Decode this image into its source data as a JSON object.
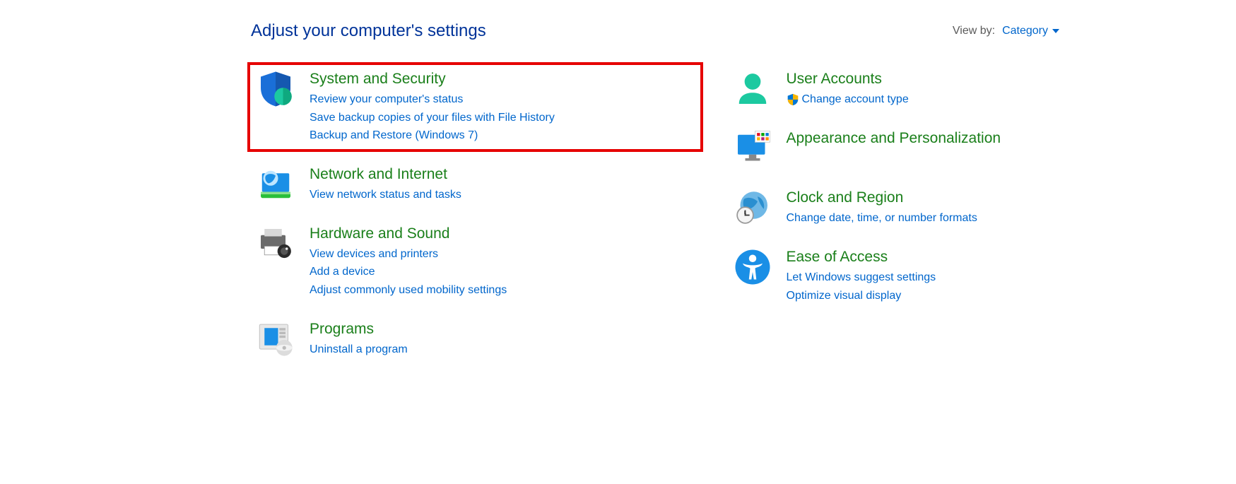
{
  "header": {
    "title": "Adjust your computer's settings",
    "view_by_label": "View by:",
    "view_by_value": "Category"
  },
  "left": [
    {
      "id": "system-and-security",
      "title": "System and Security",
      "links": [
        "Review your computer's status",
        "Save backup copies of your files with File History",
        "Backup and Restore (Windows 7)"
      ],
      "highlight": true
    },
    {
      "id": "network-and-internet",
      "title": "Network and Internet",
      "links": [
        "View network status and tasks"
      ]
    },
    {
      "id": "hardware-and-sound",
      "title": "Hardware and Sound",
      "links": [
        "View devices and printers",
        "Add a device",
        "Adjust commonly used mobility settings"
      ]
    },
    {
      "id": "programs",
      "title": "Programs",
      "links": [
        "Uninstall a program"
      ]
    }
  ],
  "right": [
    {
      "id": "user-accounts",
      "title": "User Accounts",
      "links": [
        "Change account type"
      ],
      "shielded": [
        true
      ]
    },
    {
      "id": "appearance-and-personalization",
      "title": "Appearance and Personalization",
      "links": []
    },
    {
      "id": "clock-and-region",
      "title": "Clock and Region",
      "links": [
        "Change date, time, or number formats"
      ]
    },
    {
      "id": "ease-of-access",
      "title": "Ease of Access",
      "links": [
        "Let Windows suggest settings",
        "Optimize visual display"
      ]
    }
  ]
}
